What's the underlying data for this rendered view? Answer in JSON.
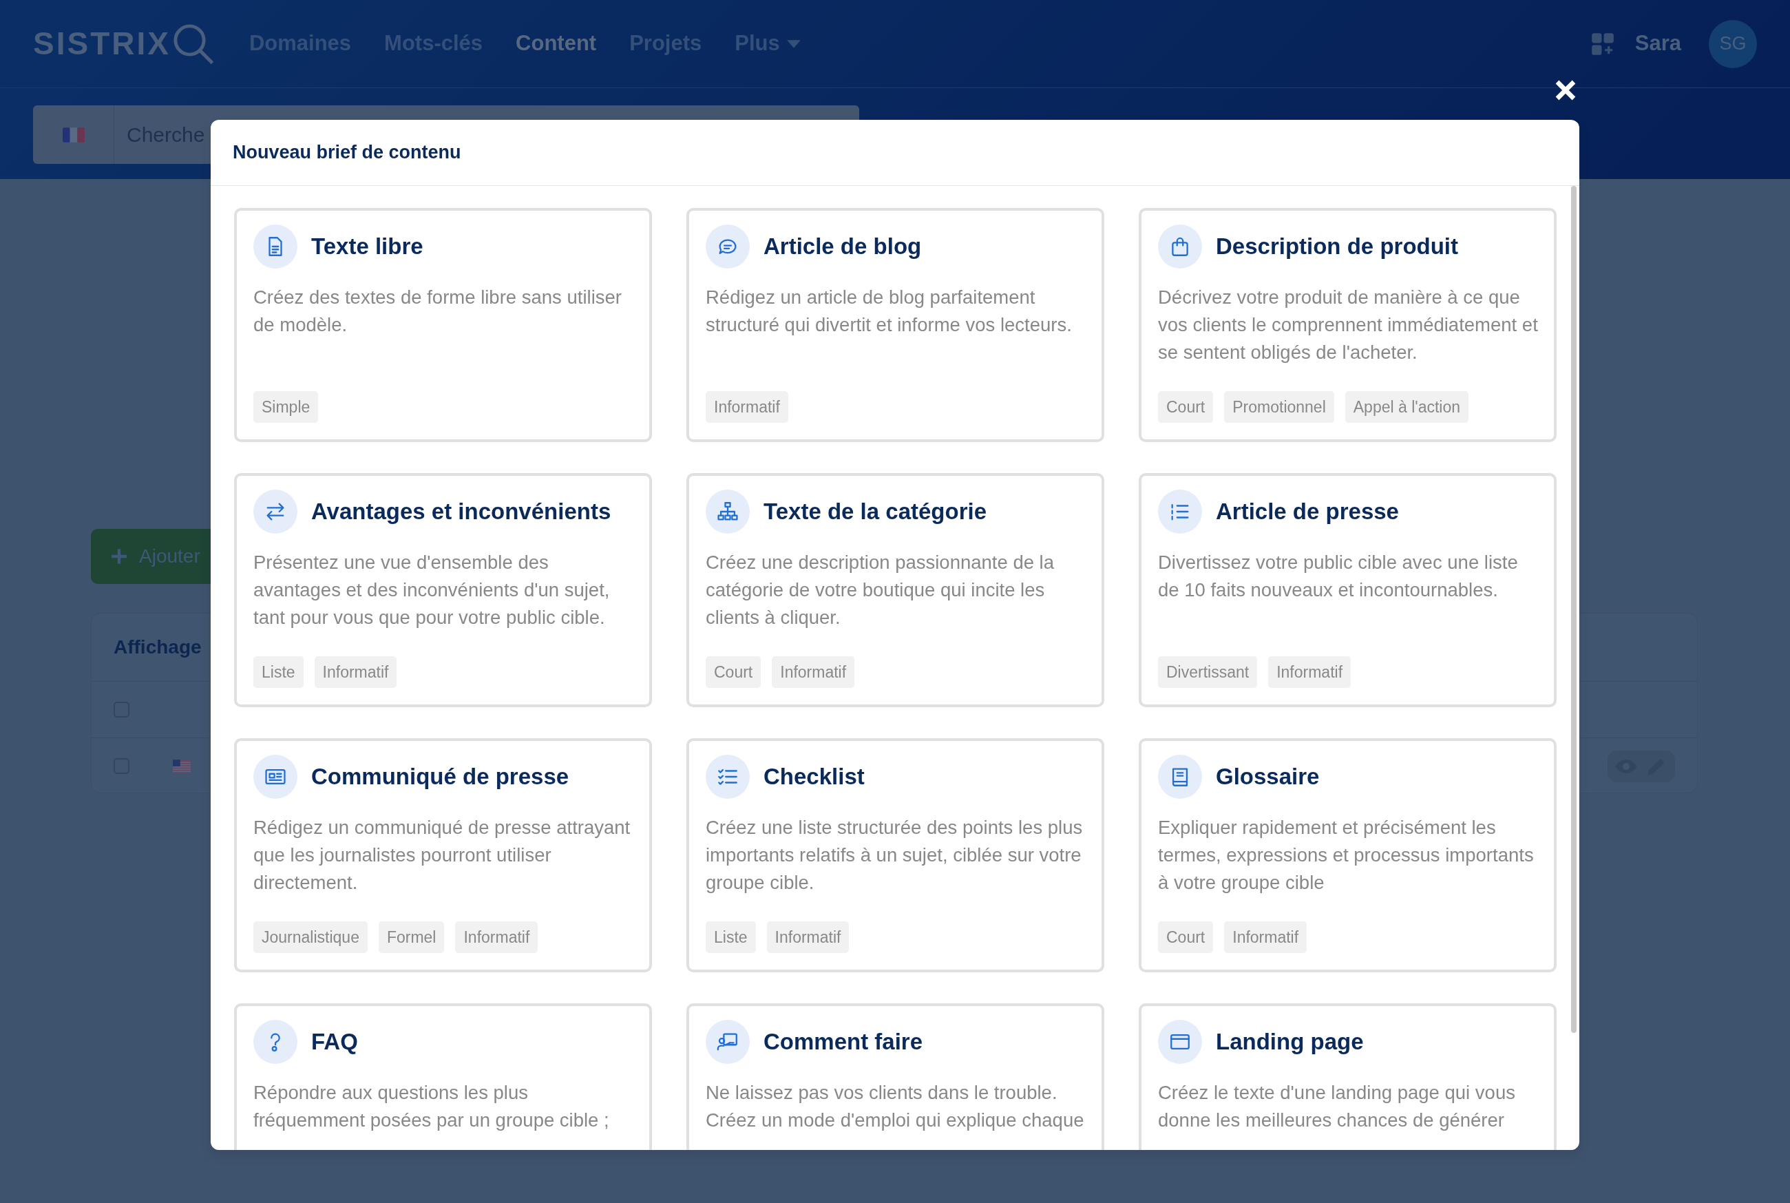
{
  "navbar": {
    "logo": "SISTRIX",
    "links": [
      {
        "label": "Domaines",
        "selected": false,
        "kind": "link"
      },
      {
        "label": "Mots-clés",
        "selected": false,
        "kind": "link"
      },
      {
        "label": "Content",
        "selected": true,
        "kind": "link"
      },
      {
        "label": "Projets",
        "selected": false,
        "kind": "link"
      },
      {
        "label": "Plus",
        "selected": false,
        "kind": "dropdown"
      }
    ],
    "user": "Sara",
    "avatar": "SG"
  },
  "search": {
    "placeholder": "Cherche"
  },
  "add_button": "Ajouter",
  "panel": {
    "title": "Affichage",
    "rows": [
      {
        "checked": false,
        "kind": "header"
      },
      {
        "checked": false,
        "kind": "item"
      }
    ]
  },
  "modal": {
    "title": "Nouveau brief de contenu",
    "cards": [
      {
        "title": "Texte libre",
        "description": "Créez des textes de forme libre sans utiliser de modèle.",
        "tags": [
          "Simple"
        ]
      },
      {
        "title": "Article de blog",
        "description": "Rédigez un article de blog parfaitement structuré qui divertit et informe vos lecteurs.",
        "tags": [
          "Informatif"
        ]
      },
      {
        "title": "Description de produit",
        "description": "Décrivez votre produit de manière à ce que vos clients le comprennent immédiatement et se sentent obligés de l'acheter.",
        "tags": [
          "Court",
          "Promotionnel",
          "Appel à l'action"
        ]
      },
      {
        "title": "Avantages et inconvénients",
        "description": "Présentez une vue d'ensemble des avantages et des inconvénients d'un sujet, tant pour vous que pour votre public cible.",
        "tags": [
          "Liste",
          "Informatif"
        ]
      },
      {
        "title": "Texte de la catégorie",
        "description": "Créez une description passionnante de la catégorie de votre boutique qui incite les clients à cliquer.",
        "tags": [
          "Court",
          "Informatif"
        ]
      },
      {
        "title": "Article de presse",
        "description": "Divertissez votre public cible avec une liste de 10 faits nouveaux et incontournables.",
        "tags": [
          "Divertissant",
          "Informatif"
        ]
      },
      {
        "title": "Communiqué de presse",
        "description": "Rédigez un communiqué de presse attrayant que les journalistes pourront utiliser directement.",
        "tags": [
          "Journalistique",
          "Formel",
          "Informatif"
        ]
      },
      {
        "title": "Checklist",
        "description": "Créez une liste structurée des points les plus importants relatifs à un sujet, ciblée sur votre groupe cible.",
        "tags": [
          "Liste",
          "Informatif"
        ]
      },
      {
        "title": "Glossaire",
        "description": "Expliquer rapidement et précisément les termes, expressions et processus importants à votre groupe cible",
        "tags": [
          "Court",
          "Informatif"
        ]
      },
      {
        "title": "FAQ",
        "description": "Répondre aux questions les plus fréquemment posées par un groupe cible ;"
      },
      {
        "title": "Comment faire",
        "description": "Ne laissez pas vos clients dans le trouble. Créez un mode d'emploi qui explique chaque"
      },
      {
        "title": "Landing page",
        "description": "Créez le texte d'une landing page qui vous donne les meilleures chances de générer"
      }
    ]
  }
}
